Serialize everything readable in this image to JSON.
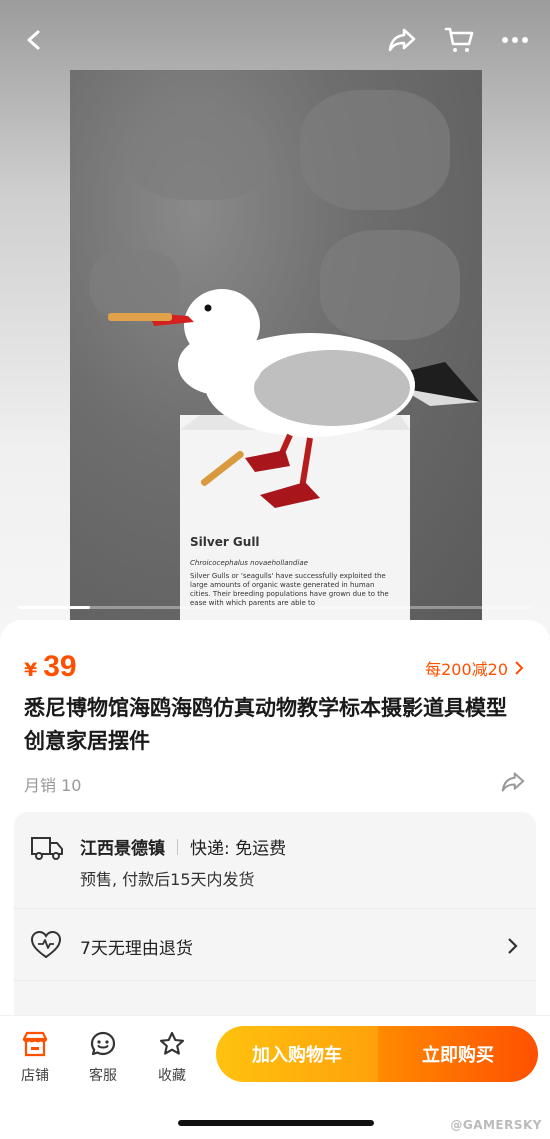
{
  "photo": {
    "plaque_title": "Silver Gull",
    "plaque_species": "Chroicocephalus novaehollandiae",
    "plaque_text": "Silver Gulls or 'seagulls' have successfully exploited the large amounts of organic waste generated in human cities. Their breeding populations have grown due to the ease with which parents are able to",
    "gallery_progress": 0.14
  },
  "header": {
    "back_icon": "back-chevron-icon",
    "share_icon": "share-icon",
    "cart_icon": "cart-icon",
    "more_icon": "more-dots-icon"
  },
  "product": {
    "price_symbol": "¥",
    "price": "39",
    "promo": "每200减20",
    "title": "悉尼博物馆海鸥海鸥仿真动物教学标本摄影道具模型创意家居摆件",
    "monthly_sales": "月销 10"
  },
  "shipping": {
    "origin": "江西景德镇",
    "method": "快递: 免运费",
    "note": "预售, 付款后15天内发货"
  },
  "returns": {
    "label": "7天无理由退货"
  },
  "bottom_bar": {
    "store": "店铺",
    "service": "客服",
    "favorite": "收藏",
    "add_to_cart": "加入购物车",
    "buy_now": "立即购买"
  },
  "watermark": "@GAMERSKY",
  "colors": {
    "accent": "#ff5000",
    "cart_button": "#ffb30e",
    "buy_button": "#ff6a00"
  }
}
